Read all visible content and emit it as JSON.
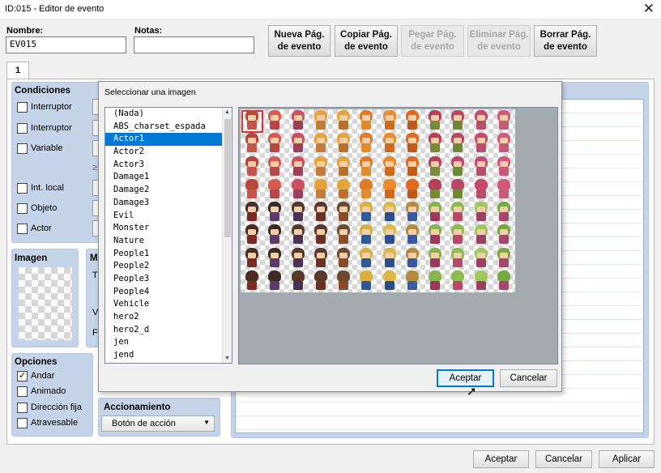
{
  "window": {
    "title": "ID:015 - Editor de evento",
    "close_glyph": "✕"
  },
  "fields": {
    "name_label": "Nombre:",
    "name_value": "EV015",
    "notes_label": "Notas:",
    "notes_value": ""
  },
  "page_buttons": {
    "new": "Nueva Pág. de evento",
    "copy": "Copiar Pág. de evento",
    "paste": "Pegar Pág. de evento",
    "delete": "Eliminar Pág. de evento",
    "clear": "Borrar Pág. de evento"
  },
  "tabs": [
    "1"
  ],
  "conditions": {
    "title": "Condiciones",
    "items": [
      "Interruptor",
      "Interruptor",
      "Variable",
      "Int. local",
      "Objeto",
      "Actor"
    ],
    "glyph": "≥"
  },
  "image_group": {
    "title": "Imagen"
  },
  "movement_group": {
    "title": "M",
    "row_letters": [
      "T",
      "V",
      "F"
    ]
  },
  "options": {
    "title": "Opciones",
    "items": [
      {
        "label": "Andar",
        "checked": true
      },
      {
        "label": "Animado",
        "checked": false
      },
      {
        "label": "Dirección fija",
        "checked": false
      },
      {
        "label": "Atravesable",
        "checked": false
      }
    ]
  },
  "trigger": {
    "title": "Accionamiento",
    "value": "Botón de acción"
  },
  "bottom_buttons": {
    "ok": "Aceptar",
    "cancel": "Cancelar",
    "apply": "Aplicar"
  },
  "dialog": {
    "title": "Seleccionar una imagen",
    "files": [
      "(Nada)",
      "ABS_charset_espada",
      "Actor1",
      "Actor2",
      "Actor3",
      "Damage1",
      "Damage2",
      "Damage3",
      "Evil",
      "Monster",
      "Nature",
      "People1",
      "People2",
      "People3",
      "People4",
      "Vehicle",
      "hero2",
      "hero2_d",
      "jen",
      "jend"
    ],
    "selected_index": 2,
    "ok": "Aceptar",
    "cancel": "Cancelar"
  },
  "sprite_palette": {
    "hair": [
      "#b8463a",
      "#d85a4e",
      "#cf4f5e",
      "#e7a23a",
      "#e3a63c",
      "#e07a28",
      "#ee8a2a",
      "#e06a1e",
      "#b63f57",
      "#b84664",
      "#c74a6c",
      "#d3577a"
    ],
    "body": [
      "#c3534d",
      "#b74848",
      "#9e3f5a",
      "#c67a3a",
      "#b8722e",
      "#e08b2c",
      "#d06a1c",
      "#c05a18",
      "#7b8a3a",
      "#6c8a36",
      "#b6506a",
      "#c65a78"
    ],
    "bottom_hair": [
      "#4a2e22",
      "#3d2a20",
      "#57382a",
      "#5a3a2c",
      "#6b4a30",
      "#d8b040",
      "#dcb848",
      "#b48b3c",
      "#8ab44c",
      "#8cbc50",
      "#a0c85a",
      "#7aa840"
    ],
    "bottom_body": [
      "#7a2a24",
      "#5c3a6a",
      "#4a3254",
      "#6c3022",
      "#8b4a2a",
      "#2e5a9a",
      "#2d4e8c",
      "#3a5aa0",
      "#9a3a5a",
      "#b6486a",
      "#9c3f60",
      "#a5466c"
    ]
  }
}
